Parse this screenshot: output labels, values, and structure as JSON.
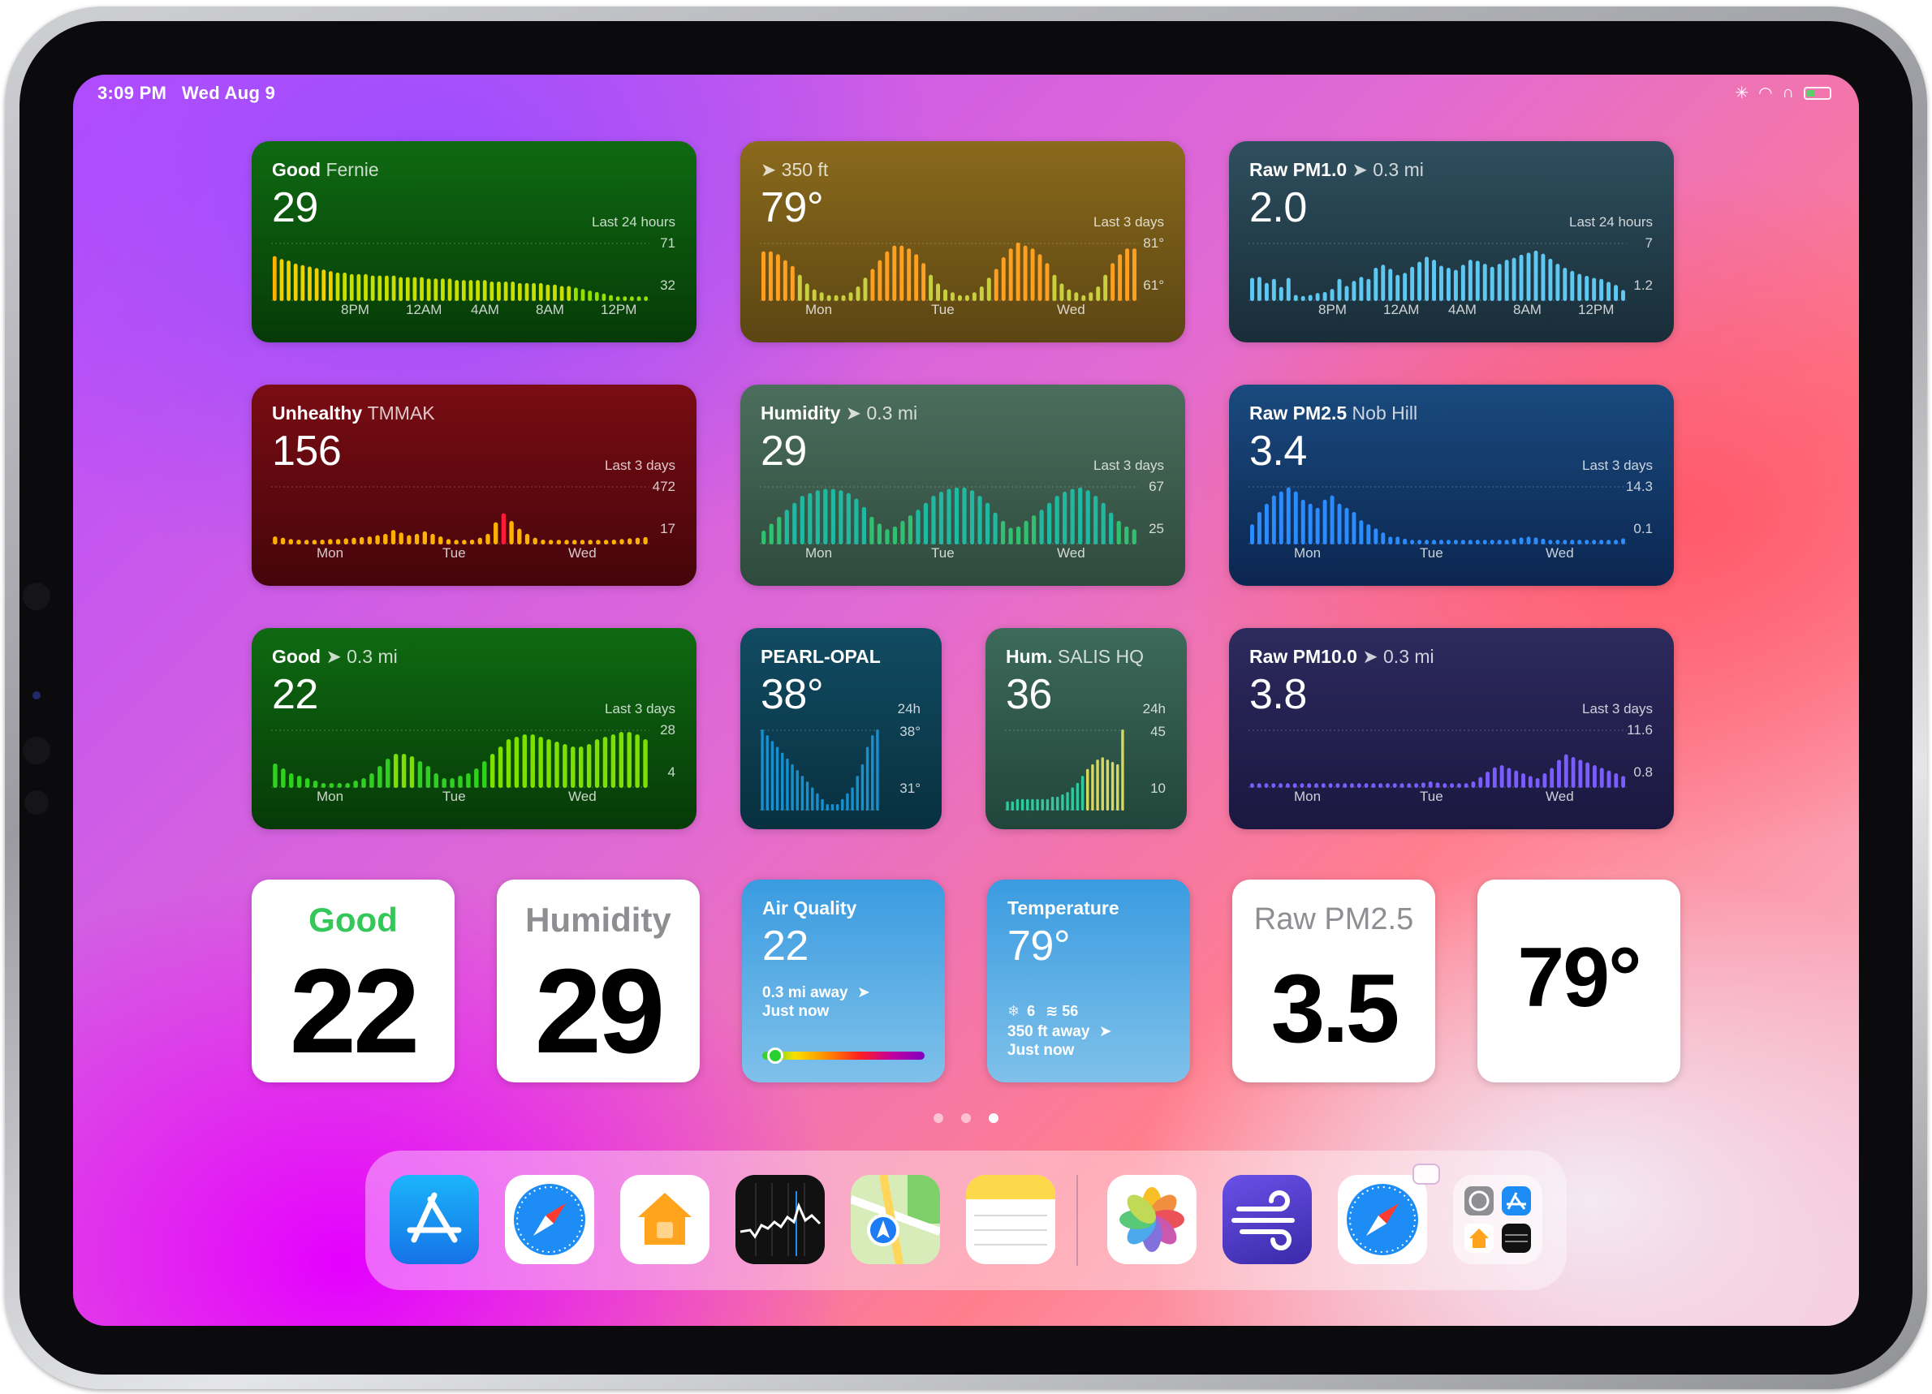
{
  "status_bar": {
    "time": "3:09 PM",
    "date": "Wed Aug 9"
  },
  "widgets": [
    {
      "id": "w1",
      "title": "Good",
      "subtitle": "Fernie",
      "value": "29",
      "period": "Last 24 hours",
      "max": "71",
      "min": "32",
      "x_labels": [
        "8PM",
        "12AM",
        "4AM",
        "8AM",
        "12PM"
      ],
      "bg": [
        "#0f6a12",
        "#063a07"
      ]
    },
    {
      "id": "w2",
      "title": "",
      "subtitle": "350 ft",
      "value": "79°",
      "period": "Last 3 days",
      "max": "81°",
      "min": "61°",
      "x_labels": [
        "Mon",
        "Tue",
        "Wed"
      ],
      "bg": [
        "#8a6a1c",
        "#5b4512"
      ]
    },
    {
      "id": "w3",
      "title": "Raw PM1.0",
      "subtitle": "0.3 mi",
      "value": "2.0",
      "period": "Last 24 hours",
      "max": "7",
      "min": "1.2",
      "x_labels": [
        "8PM",
        "12AM",
        "4AM",
        "8AM",
        "12PM"
      ],
      "bg": [
        "#2f4f5e",
        "#182d38"
      ]
    },
    {
      "id": "w4",
      "title": "Unhealthy",
      "subtitle": "TMMAK",
      "value": "156",
      "period": "Last 3 days",
      "max": "472",
      "min": "17",
      "x_labels": [
        "Mon",
        "Tue",
        "Wed"
      ],
      "bg": [
        "#7a0c14",
        "#44050a"
      ]
    },
    {
      "id": "w5",
      "title": "Humidity",
      "subtitle": "0.3 mi",
      "value": "29",
      "period": "Last 3 days",
      "max": "67",
      "min": "25",
      "x_labels": [
        "Mon",
        "Tue",
        "Wed"
      ],
      "bg": [
        "#4c6e5d",
        "#2e4a3d"
      ]
    },
    {
      "id": "w6",
      "title": "Raw PM2.5",
      "subtitle": "Nob Hill",
      "value": "3.4",
      "period": "Last 3 days",
      "max": "14.3",
      "min": "0.1",
      "x_labels": [
        "Mon",
        "Tue",
        "Wed"
      ],
      "bg": [
        "#1a4a7e",
        "#0b2650"
      ]
    },
    {
      "id": "w7",
      "title": "Good",
      "subtitle": "0.3 mi",
      "value": "22",
      "period": "Last 3 days",
      "max": "28",
      "min": "4",
      "x_labels": [
        "Mon",
        "Tue",
        "Wed"
      ],
      "bg": [
        "#0f6a12",
        "#063a07"
      ]
    },
    {
      "id": "w8",
      "title": "PEARL-OPAL",
      "subtitle": "",
      "value": "38°",
      "period": "24h",
      "max": "38°",
      "min": "31°",
      "x_labels": [],
      "bg": [
        "#114b62",
        "#08303f"
      ]
    },
    {
      "id": "w9",
      "title": "Hum.",
      "subtitle": "SALIS HQ",
      "value": "36",
      "period": "24h",
      "max": "45",
      "min": "10",
      "x_labels": [],
      "bg": [
        "#3d6a5a",
        "#21453a"
      ]
    },
    {
      "id": "w10",
      "title": "Raw PM10.0",
      "subtitle": "0.3 mi",
      "value": "3.8",
      "period": "Last 3 days",
      "max": "11.6",
      "min": "0.8",
      "x_labels": [
        "Mon",
        "Tue",
        "Wed"
      ],
      "bg": [
        "#2d2a5e",
        "#1a1740"
      ]
    }
  ],
  "small_widgets": {
    "good": {
      "label": "Good",
      "value": "22",
      "label_color": "#34c759"
    },
    "humidity": {
      "label": "Humidity",
      "value": "29",
      "label_color": "#8e8e93"
    },
    "air_quality": {
      "title": "Air Quality",
      "value": "22",
      "distance": "0.3 mi away",
      "time": "Just now",
      "indicator_fraction": 0.08
    },
    "temperature": {
      "title": "Temperature",
      "value": "79°",
      "wind_dir": "6",
      "wind_speed": "56",
      "distance": "350 ft away",
      "time": "Just now"
    },
    "pm25": {
      "label": "Raw PM2.5",
      "value": "3.5",
      "label_color": "#8e8e93"
    },
    "temp_big": {
      "value": "79°"
    }
  },
  "page_dots": {
    "count": 3,
    "active": 2
  },
  "dock": {
    "apps": [
      {
        "name": "App Store",
        "icon": "app-store-icon"
      },
      {
        "name": "Safari",
        "icon": "safari-icon"
      },
      {
        "name": "Home",
        "icon": "home-icon"
      },
      {
        "name": "Stocks",
        "icon": "stocks-icon"
      },
      {
        "name": "Maps",
        "icon": "maps-icon"
      },
      {
        "name": "Notes",
        "icon": "notes-icon"
      },
      {
        "name": "Photos",
        "icon": "photos-icon"
      },
      {
        "name": "Wind",
        "icon": "wind-icon"
      },
      {
        "name": "Safari",
        "icon": "safari-icon"
      },
      {
        "name": "App Library",
        "icon": "app-library-icon"
      }
    ]
  },
  "chart_data": [
    {
      "type": "bar",
      "id": "w1",
      "values": [
        62,
        60,
        59,
        57,
        56,
        55,
        54,
        53,
        52,
        51,
        51,
        50,
        50,
        50,
        49,
        49,
        49,
        49,
        48,
        48,
        48,
        48,
        47,
        47,
        47,
        47,
        46,
        46,
        46,
        46,
        46,
        45,
        45,
        45,
        45,
        44,
        44,
        44,
        44,
        43,
        43,
        42,
        42,
        41,
        40,
        39,
        38,
        37,
        36,
        35,
        34,
        33,
        33,
        32
      ],
      "colors": [
        "#ffb300",
        "#f0d000",
        "#c8e000",
        "#96e000"
      ],
      "ylim": [
        32,
        71
      ]
    },
    {
      "type": "bar",
      "id": "w2",
      "values": [
        78,
        78,
        77,
        75,
        73,
        70,
        67,
        65,
        64,
        63,
        63,
        63,
        64,
        66,
        69,
        72,
        75,
        78,
        80,
        80,
        79,
        77,
        74,
        70,
        67,
        65,
        64,
        63,
        63,
        64,
        66,
        69,
        72,
        76,
        79,
        81,
        80,
        79,
        77,
        74,
        70,
        67,
        65,
        64,
        63,
        64,
        66,
        70,
        74,
        77,
        79,
        79
      ],
      "colors": [
        "#ffa020",
        "#c8d040"
      ],
      "ylim": [
        61,
        81
      ]
    },
    {
      "type": "bar",
      "id": "w3",
      "values": [
        3.5,
        3.6,
        3.0,
        3.4,
        2.6,
        3.5,
        1.8,
        1.7,
        1.8,
        2.0,
        2.1,
        2.4,
        3.4,
        2.7,
        3.2,
        3.6,
        3.4,
        4.5,
        4.8,
        4.4,
        3.8,
        4.0,
        4.6,
        5.1,
        5.6,
        5.3,
        4.7,
        4.5,
        4.3,
        4.8,
        5.3,
        5.2,
        4.9,
        4.6,
        4.9,
        5.3,
        5.5,
        5.8,
        6.0,
        6.2,
        5.9,
        5.4,
        4.9,
        4.5,
        4.2,
        3.9,
        3.7,
        3.5,
        3.4,
        3.1,
        2.8,
        2.3
      ],
      "colors": [
        "#5ec8f0"
      ],
      "ylim": [
        1.2,
        7
      ]
    },
    {
      "type": "bar",
      "id": "w4",
      "values": [
        80,
        70,
        60,
        55,
        50,
        50,
        55,
        60,
        60,
        65,
        70,
        75,
        80,
        90,
        100,
        130,
        110,
        90,
        100,
        120,
        100,
        80,
        60,
        45,
        40,
        55,
        70,
        100,
        190,
        260,
        200,
        140,
        100,
        70,
        55,
        45,
        40,
        35,
        35,
        35,
        40,
        45,
        50,
        55,
        60,
        65,
        70,
        75
      ],
      "colors": [
        "#ff1a3a",
        "#ffb000"
      ],
      "ylim": [
        17,
        472
      ]
    },
    {
      "type": "bar",
      "id": "w5",
      "values": [
        35,
        40,
        45,
        50,
        55,
        60,
        62,
        64,
        65,
        65,
        64,
        62,
        58,
        52,
        45,
        40,
        36,
        38,
        42,
        46,
        50,
        55,
        60,
        63,
        65,
        66,
        66,
        64,
        60,
        55,
        48,
        42,
        37,
        38,
        42,
        46,
        50,
        55,
        60,
        63,
        65,
        66,
        64,
        60,
        55,
        48,
        42,
        38,
        36
      ],
      "colors": [
        "#20b8a0",
        "#30c070"
      ],
      "ylim": [
        25,
        67
      ]
    },
    {
      "type": "bar",
      "id": "w6",
      "values": [
        5,
        8,
        10,
        12,
        13,
        14,
        13,
        11,
        10,
        9,
        11,
        12,
        10,
        9,
        8,
        6,
        5,
        4,
        3,
        2,
        2,
        1.5,
        1.2,
        1,
        0.8,
        0.6,
        0.5,
        0.4,
        0.4,
        0.3,
        0.3,
        0.3,
        0.4,
        0.5,
        0.8,
        1.2,
        1.5,
        1.8,
        2.0,
        1.8,
        1.5,
        1.2,
        0.8,
        0.5,
        0.4,
        0.3,
        0.4,
        0.6,
        0.8,
        1,
        1.2,
        1.6
      ],
      "colors": [
        "#2a8cff"
      ],
      "ylim": [
        0.1,
        14.3
      ]
    },
    {
      "type": "bar",
      "id": "w7",
      "values": [
        14,
        12,
        10,
        9,
        8,
        7,
        6,
        6,
        6,
        6,
        7,
        8,
        10,
        13,
        16,
        18,
        18,
        17,
        15,
        13,
        10,
        8,
        8,
        9,
        10,
        12,
        15,
        18,
        21,
        24,
        25,
        26,
        26,
        25,
        24,
        23,
        22,
        21,
        21,
        22,
        24,
        25,
        26,
        27,
        27,
        26,
        24
      ],
      "colors": [
        "#7ce000",
        "#30d020"
      ],
      "ylim": [
        4,
        28
      ]
    },
    {
      "type": "bar",
      "id": "w8",
      "values": [
        38,
        37.5,
        37,
        36.5,
        36,
        35.5,
        35,
        34.5,
        34,
        33.5,
        33,
        32.5,
        32,
        31.5,
        31.2,
        31.5,
        32,
        32.5,
        33,
        34,
        35,
        36.5,
        37.5,
        38
      ],
      "colors": [
        "#1890d0"
      ],
      "ylim": [
        31,
        38
      ]
    },
    {
      "type": "bar",
      "id": "w9",
      "values": [
        14,
        14,
        15,
        15,
        15,
        15,
        15,
        15,
        15,
        16,
        16,
        17,
        18,
        20,
        22,
        25,
        28,
        30,
        32,
        33,
        32,
        31,
        30,
        45
      ],
      "colors": [
        "#d8d860",
        "#30c8a0"
      ],
      "ylim": [
        10,
        45
      ]
    },
    {
      "type": "bar",
      "id": "w10",
      "values": [
        1.2,
        1.1,
        1.0,
        1.0,
        1.1,
        1.2,
        1.0,
        0.9,
        1.0,
        1.1,
        1.2,
        1.1,
        1.0,
        1.0,
        1.1,
        1.2,
        1.3,
        1.2,
        1.1,
        1.0,
        1.0,
        1.2,
        1.4,
        1.6,
        1.8,
        2.0,
        1.8,
        1.5,
        1.3,
        1.2,
        1.5,
        2.0,
        2.8,
        3.8,
        4.6,
        5.0,
        4.5,
        4.0,
        3.5,
        3.0,
        2.6,
        3.5,
        4.5,
        6.0,
        7.0,
        6.5,
        6.0,
        5.5,
        5.0,
        4.5,
        4.0,
        3.5,
        3.0
      ],
      "colors": [
        "#7b5cff"
      ],
      "ylim": [
        0.8,
        11.6
      ]
    }
  ]
}
